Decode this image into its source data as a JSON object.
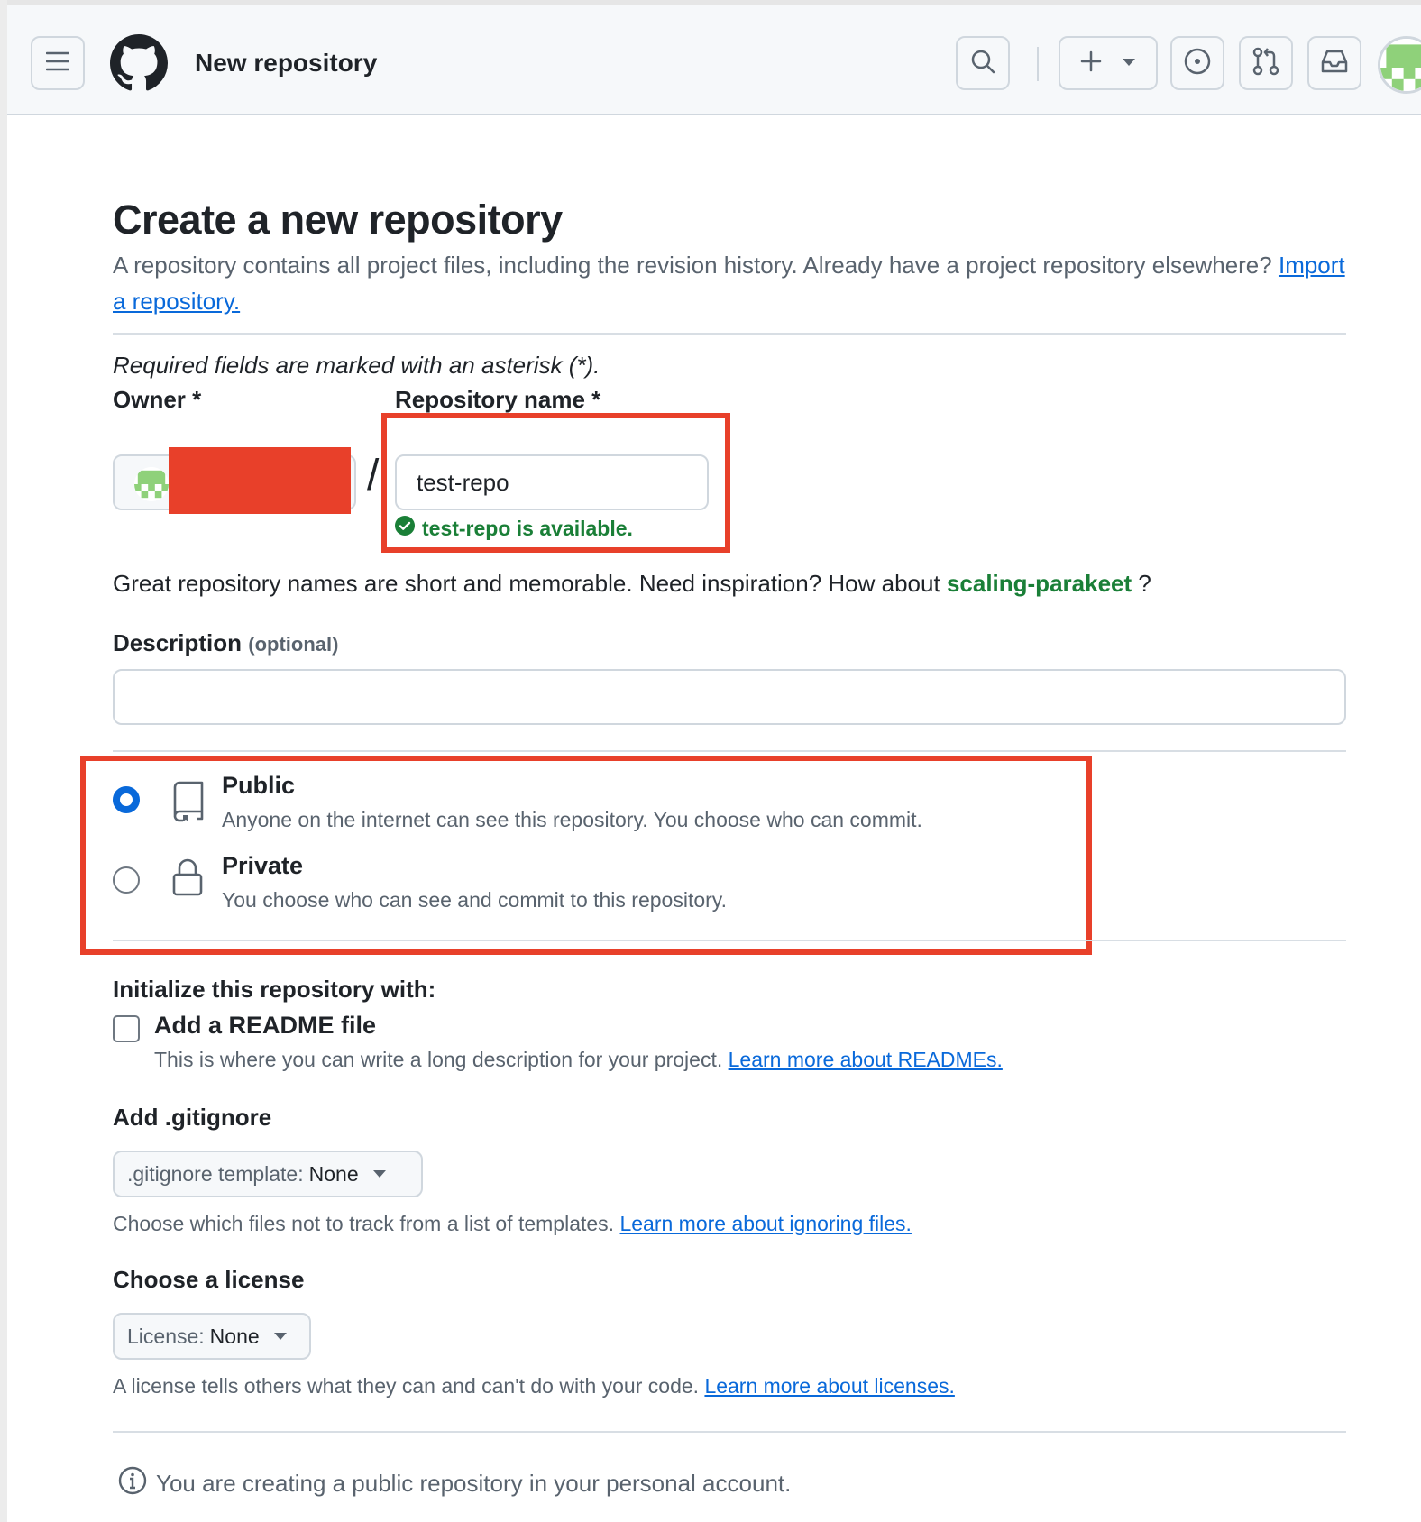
{
  "header": {
    "title": "New repository",
    "icons": [
      "hamburger-menu-icon",
      "github-logo-icon",
      "search-icon",
      "plus-icon",
      "chevron-down-icon",
      "issues-icon",
      "pull-request-icon",
      "inbox-icon"
    ]
  },
  "page": {
    "title": "Create a new repository",
    "intro_text": "A repository contains all project files, including the revision history. Already have a project repository elsewhere?",
    "import_link": "Import a repository.",
    "required_note": "Required fields are marked with an asterisk (*)."
  },
  "owner": {
    "label": "Owner *",
    "separator": "/"
  },
  "repo_name": {
    "label": "Repository name *",
    "value": "test-repo",
    "availability": "test-repo is available."
  },
  "inspiration": {
    "text": "Great repository names are short and memorable. Need inspiration? How about",
    "suggestion": "scaling-parakeet",
    "suffix": "?"
  },
  "description": {
    "label": "Description",
    "optional": "(optional)",
    "value": ""
  },
  "visibility": {
    "public": {
      "title": "Public",
      "description": "Anyone on the internet can see this repository. You choose who can commit.",
      "selected": true
    },
    "private": {
      "title": "Private",
      "description": "You choose who can see and commit to this repository.",
      "selected": false
    }
  },
  "initialize": {
    "title": "Initialize this repository with:",
    "readme_label": "Add a README file",
    "readme_help": "This is where you can write a long description for your project.",
    "readme_link": "Learn more about READMEs.",
    "readme_checked": false
  },
  "gitignore": {
    "title": "Add .gitignore",
    "select_prefix": ".gitignore template:",
    "select_value": "None",
    "help": "Choose which files not to track from a list of templates.",
    "link": "Learn more about ignoring files."
  },
  "license": {
    "title": "Choose a license",
    "select_prefix": "License:",
    "select_value": "None",
    "help": "A license tells others what they can and can't do with your code.",
    "link": "Learn more about licenses."
  },
  "footer_note": "You are creating a public repository in your personal account.",
  "colors": {
    "accent_blue": "#0969da",
    "success_green": "#1a7f37",
    "annotation_red": "#e8402a",
    "border": "#d0d7de",
    "muted_text": "#59636e"
  }
}
